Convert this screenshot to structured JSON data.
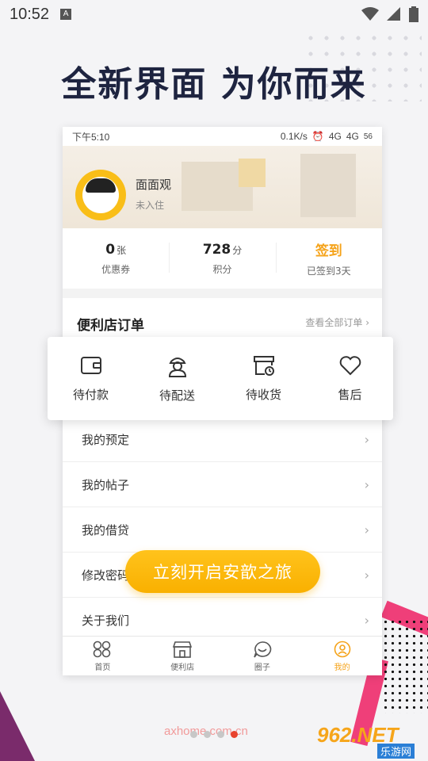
{
  "os_status": {
    "time": "10:52",
    "a_badge": "A"
  },
  "headline": "全新界面  为你而来",
  "phone": {
    "status": {
      "time": "下午5:10",
      "right_text": "0.1K/s",
      "net1": "4G",
      "net2": "4G",
      "battery": "56"
    },
    "profile": {
      "name": "面面观",
      "status": "未入住"
    },
    "stats": [
      {
        "value": "0",
        "unit": "张",
        "label": "优惠券"
      },
      {
        "value": "728",
        "unit": "分",
        "label": "积分"
      },
      {
        "value": "签到",
        "unit": "",
        "label": "已签到3天"
      }
    ],
    "orders": {
      "title": "便利店订单",
      "more": "查看全部订单 ›"
    },
    "order_status": [
      {
        "label": "待付款",
        "icon": "wallet-icon"
      },
      {
        "label": "待配送",
        "icon": "delivery-person-icon"
      },
      {
        "label": "待收货",
        "icon": "package-clock-icon"
      },
      {
        "label": "售后",
        "icon": "heart-icon"
      }
    ],
    "menu": [
      {
        "label": "我的预定"
      },
      {
        "label": "我的帖子"
      },
      {
        "label": "我的借贷"
      },
      {
        "label": "修改密码"
      },
      {
        "label": "关于我们"
      }
    ],
    "tabs": [
      {
        "label": "首页",
        "icon": "home-grid-icon"
      },
      {
        "label": "便利店",
        "icon": "store-icon"
      },
      {
        "label": "圈子",
        "icon": "chat-bubble-icon"
      },
      {
        "label": "我的",
        "icon": "profile-icon",
        "active": true
      }
    ]
  },
  "cta": "立刻开启安歆之旅",
  "watermark": "axhome.com.cn",
  "logo": {
    "main": "962.NET",
    "sub": "乐游网"
  },
  "colors": {
    "accent": "#f9b000",
    "pink": "#ef3f79",
    "navy": "#1e2440"
  }
}
